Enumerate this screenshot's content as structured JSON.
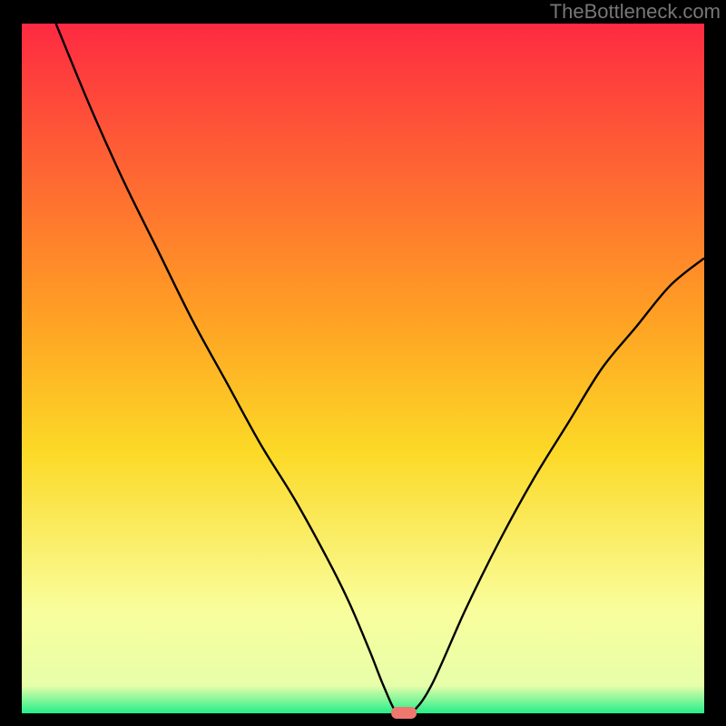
{
  "watermark": "TheBottleneck.com",
  "colors": {
    "black": "#000000",
    "red": "#fe2a42",
    "orange": "#ff9f24",
    "yellow_mid": "#fcd926",
    "pale_yellow": "#f9fe9c",
    "green": "#23ee8b",
    "curve": "#000000",
    "marker": "#ef776d",
    "watermark": "#777777"
  },
  "chart_data": {
    "type": "line",
    "title": "",
    "xlabel": "",
    "ylabel": "",
    "xlim": [
      0,
      100
    ],
    "ylim": [
      0,
      100
    ],
    "x": [
      5,
      10,
      15,
      20,
      25,
      30,
      35,
      40,
      45,
      48,
      51,
      53,
      55,
      57,
      60,
      65,
      70,
      75,
      80,
      85,
      90,
      95,
      100
    ],
    "values": [
      100,
      88,
      77,
      67,
      57,
      48,
      39,
      31,
      22,
      16,
      9,
      4,
      0,
      0,
      4,
      15,
      25,
      34,
      42,
      50,
      56,
      62,
      66
    ],
    "marker": {
      "x": 56,
      "y": 0
    },
    "gradient_stops": [
      {
        "offset": 0.0,
        "color": "#fe2a42"
      },
      {
        "offset": 0.42,
        "color": "#ff9f24"
      },
      {
        "offset": 0.62,
        "color": "#fcd926"
      },
      {
        "offset": 0.85,
        "color": "#f9fe9c"
      },
      {
        "offset": 0.96,
        "color": "#e7fea9"
      },
      {
        "offset": 1.0,
        "color": "#23ee8b"
      }
    ]
  }
}
